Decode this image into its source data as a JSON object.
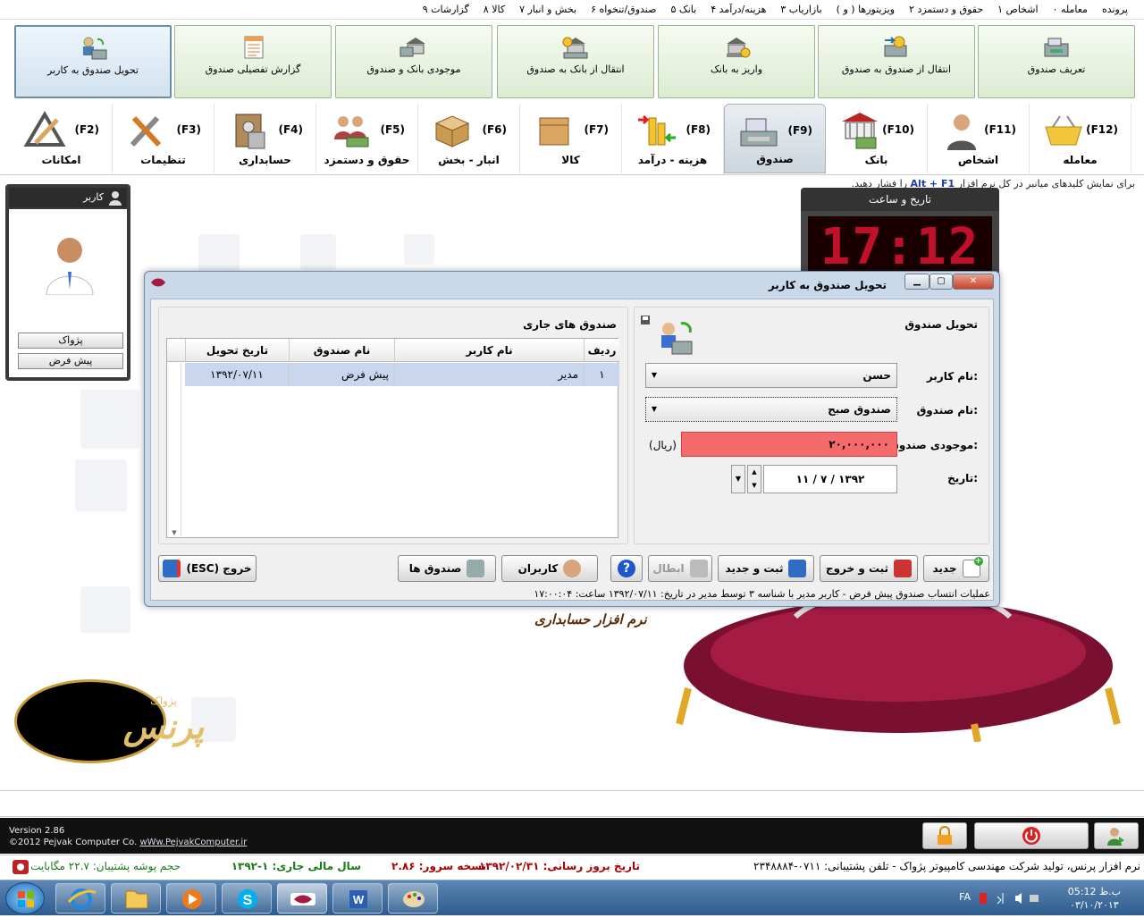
{
  "menu": [
    "پرونده",
    "۰ معامله",
    "۱ اشخاص",
    "۲ حقوق و دستمزد",
    "( و ) ویزیتورها",
    "۳ بازاریاب",
    "۴ هزینه/درآمد",
    "۵ بانک",
    "۶ صندوق/تنخواه",
    "۷ بخش و انبار",
    "۸ کالا",
    "۹ گزارشات"
  ],
  "subtoolbar": [
    {
      "label": "تعریف صندوق",
      "icon": "cash-register-icon"
    },
    {
      "label": "انتقال از صندوق به صندوق",
      "icon": "cash-transfer-icon"
    },
    {
      "label": "واریز به بانک",
      "icon": "bank-deposit-icon"
    },
    {
      "label": "انتقال از بانک به صندوق",
      "icon": "bank-to-cash-icon"
    },
    {
      "label": "موجودی بانک و صندوق",
      "icon": "bank-balance-icon"
    },
    {
      "label": "گزارش تفصیلی صندوق",
      "icon": "report-sheet-icon"
    },
    {
      "label": "تحویل صندوق به کاربر",
      "icon": "cash-to-user-icon"
    }
  ],
  "tabs": [
    {
      "key": "(F12)",
      "label": "معامله",
      "icon": "shopping-basket-icon"
    },
    {
      "key": "(F11)",
      "label": "اشخاص",
      "icon": "person-icon"
    },
    {
      "key": "(F10)",
      "label": "بانک",
      "icon": "bank-building-icon"
    },
    {
      "key": "(F9)",
      "label": "صندوق",
      "icon": "cash-register-icon"
    },
    {
      "key": "(F8)",
      "label": "هزینه - درآمد",
      "icon": "money-arrows-icon"
    },
    {
      "key": "(F7)",
      "label": "کالا",
      "icon": "box-icon"
    },
    {
      "key": "(F6)",
      "label": "انبار - بخش",
      "icon": "warehouse-boxes-icon"
    },
    {
      "key": "(F5)",
      "label": "حقوق و دستمزد",
      "icon": "payroll-people-icon"
    },
    {
      "key": "(F4)",
      "label": "حسابداری",
      "icon": "calculator-safe-icon"
    },
    {
      "key": "(F3)",
      "label": "تنظیمات",
      "icon": "tools-icon"
    },
    {
      "key": "(F2)",
      "label": "امکانات",
      "icon": "drafting-tools-icon"
    }
  ],
  "hint": {
    "pre": "برای نمایش کلیدهای میانبر در کل نرم افزار ",
    "keys": "Alt + F1",
    "post": " را فشار دهید."
  },
  "user_panel": {
    "title": "کاربر",
    "company": "پژواک",
    "fund": "پیش فرض"
  },
  "clock": {
    "title": "تاریخ و ساعت",
    "time": "17:12"
  },
  "dialog": {
    "title": "تحویل صندوق به کاربر",
    "window_buttons": {
      "min": "▁",
      "max": "▢",
      "close": "✕"
    },
    "left_group_title": "صندوق های جاری",
    "right_group_title": "تحویل صندوق",
    "fields": {
      "user_label": "نام کاربر:",
      "user_value": "حسن",
      "fund_label": "نام صندوق:",
      "fund_value": "صندوق صبح",
      "balance_label": "موجودی صندوق:",
      "balance_value": "۲۰,۰۰۰,۰۰۰",
      "currency": "(ریال)",
      "date_label": "تاریخ:",
      "date_value": "۱۱ / ۷ / ۱۳۹۲"
    },
    "grid": {
      "headers": [
        "ردیف",
        "نام کاربر",
        "نام صندوق",
        "تاریخ تحویل"
      ],
      "rows": [
        [
          "۱",
          "مدیر",
          "پیش فرض",
          "۱۳۹۲/۰۷/۱۱"
        ]
      ]
    },
    "buttons": {
      "new": "جدید",
      "save_exit": "ثبت و خروج",
      "save_new": "ثبت و جدید",
      "cancel": "ابطال",
      "users": "کاربران",
      "funds": "صندوق ها",
      "exit": "خروج (ESC)"
    },
    "status": "عملیات انتساب صندوق پیش فرض - کاربر مدیر با شناسه ۳ توسط مدیر در تاریخ: ۱۳۹۲/۰۷/۱۱ ساعت: ۱۷:۰۰:۰۴"
  },
  "tagline": "نرم افزار حسابداری",
  "logo": {
    "small": "پژواک",
    "big": "پرنس"
  },
  "footer": {
    "version": "Version 2.86",
    "copyright": "©2012 Pejvak Computer Co.",
    "url": "wWw.PejvakComputer.ir"
  },
  "infobar": {
    "company": "نرم افزار پرنس، تولید شرکت مهندسی کامپیوتر پژواک - تلفن پشتیبانی: ۰۷۱۱-۲۳۴۸۸۸۴",
    "update": "تاریخ بروز رسانی: ۱۳۹۲/۰۲/۳۱",
    "server": "نسخه سرور: ۲.۸۶",
    "year": "سال مالی جاری: ۱-۱۳۹۲",
    "backup": "حجم پوشه پشتیبان: ۲۲.۷ مگابایت"
  },
  "taskbar": {
    "lang": "FA",
    "time": "05:12 ب.ظ",
    "date": "۰۳/۱۰/۲۰۱۳"
  },
  "colors": {
    "accent": "#c9d9ea",
    "balance_bg": "#f56a6a",
    "clock_digits": "#c0102a",
    "selected_row": "#c9d6ee"
  }
}
